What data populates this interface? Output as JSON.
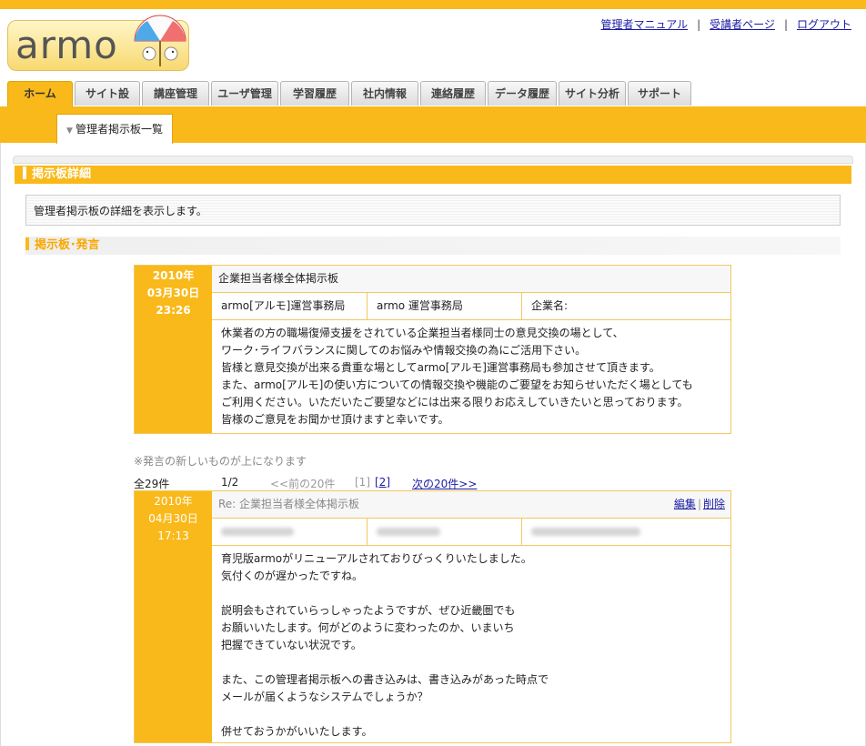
{
  "brand": {
    "logo_text": "armo"
  },
  "header": {
    "links": [
      {
        "label": "管理者マニュアル"
      },
      {
        "label": "受講者ページ"
      },
      {
        "label": "ログアウト"
      }
    ],
    "separator": "|"
  },
  "tabs": [
    {
      "label": "ホーム",
      "active": true
    },
    {
      "label": "サイト設定"
    },
    {
      "label": "講座管理"
    },
    {
      "label": "ユーザ管理"
    },
    {
      "label": "学習履歴"
    },
    {
      "label": "社内情報"
    },
    {
      "label": "連絡履歴"
    },
    {
      "label": "データ履歴"
    },
    {
      "label": "サイト分析"
    },
    {
      "label": "サポート"
    }
  ],
  "subtab": {
    "label": "管理者掲示板一覧"
  },
  "section": {
    "title": "掲示板詳細",
    "description": "管理者掲示板の詳細を表示します。",
    "subtitle": "掲示板･発言"
  },
  "board_post": {
    "date_year": "2010年",
    "date_md": "03月30日",
    "date_time": "23:26",
    "title": "企業担当者様全体掲示板",
    "author": "armo[アルモ]運営事務局",
    "name": "armo 運営事務局",
    "company_label": "企業名:",
    "body": [
      "休業者の方の職場復帰支援をされている企業担当者様同士の意見交換の場として、",
      "ワーク･ライフバランスに関してのお悩みや情報交換の為にご活用下さい。",
      "皆様と意見交換が出来る貴重な場としてarmo[アルモ]運営事務局も参加させて頂きます。",
      "また、armo[アルモ]の使い方についての情報交換や機能のご要望をお知らせいただく場としても",
      "ご利用ください。いただいたご要望などには出来る限りお応えしていきたいと思っております。",
      "皆様のご意見をお聞かせ頂けますと幸いです。"
    ]
  },
  "note": "※発言の新しいものが上になります",
  "pager": {
    "total": "全29件",
    "page": "1/2",
    "prev": "<<前の20件",
    "page1": "[1]",
    "page2": "[2]",
    "next": "次の20件>>"
  },
  "reply": {
    "date_year": "2010年",
    "date_md": "04月30日",
    "date_time": "17:13",
    "title": "Re: 企業担当者様全体掲示板",
    "edit_label": "編集",
    "delete_label": "削除",
    "body": [
      "育児版armoがリニューアルされておりびっくりいたしました。",
      "気付くのが遅かったですね。",
      "",
      "説明会もされていらっしゃったようですが、ぜひ近畿圏でも",
      "お願いいたします。何がどのように変わったのか、いまいち",
      "把握できていない状況です。",
      "",
      "また、この管理者掲示板への書き込みは、書き込みがあった時点で",
      "メールが届くようなシステムでしょうか？",
      "",
      "併せておうかがいいたします。"
    ]
  },
  "colors": {
    "accent": "#f9b91a",
    "link": "#1a1aa6"
  }
}
